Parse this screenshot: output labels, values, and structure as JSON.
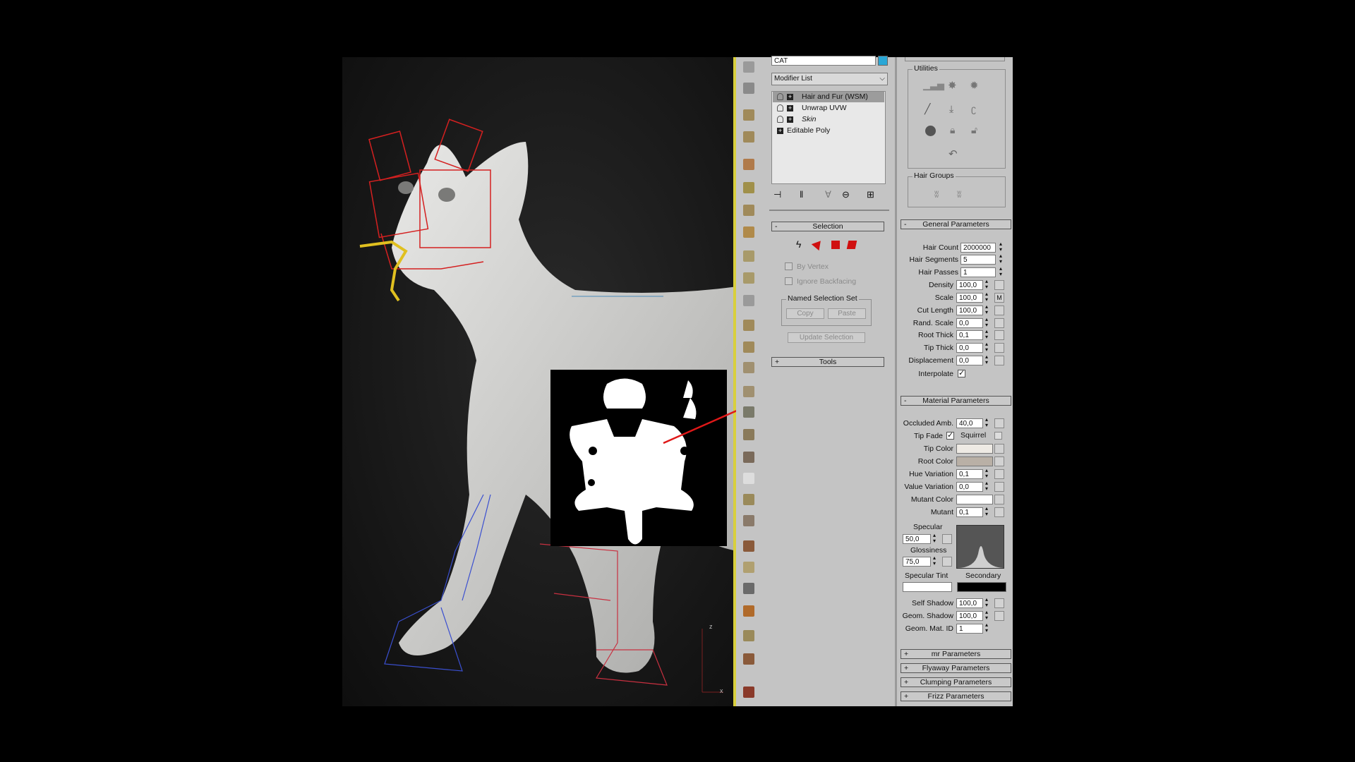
{
  "command_panel": {
    "object_name": "CAT",
    "object_color": "#2aa7d6",
    "modifier_list_label": "Modifier List",
    "stack": [
      {
        "label": "Hair and Fur (WSM)",
        "selected": true,
        "italic": false
      },
      {
        "label": "Unwrap UVW",
        "selected": false,
        "italic": false
      },
      {
        "label": "Skin",
        "selected": false,
        "italic": true
      },
      {
        "label": "Editable Poly",
        "selected": false,
        "italic": false
      }
    ]
  },
  "selection_rollout": {
    "sign": "-",
    "title": "Selection",
    "by_vertex": "By Vertex",
    "ignore_backfacing": "Ignore Backfacing",
    "named_selection_set": "Named Selection Set",
    "copy": "Copy",
    "paste": "Paste",
    "update_selection": "Update Selection"
  },
  "tools_rollout": {
    "sign": "+",
    "title": "Tools"
  },
  "utilities": {
    "title": "Utilities",
    "hair_groups_title": "Hair Groups"
  },
  "general_parameters": {
    "sign": "-",
    "title": "General Parameters",
    "rows": [
      {
        "label": "Hair Count",
        "value": "2000000"
      },
      {
        "label": "Hair Segments",
        "value": "5"
      },
      {
        "label": "Hair Passes",
        "value": "1"
      },
      {
        "label": "Density",
        "value": "100,0"
      },
      {
        "label": "Scale",
        "value": "100,0",
        "map": "M"
      },
      {
        "label": "Cut Length",
        "value": "100,0"
      },
      {
        "label": "Rand. Scale",
        "value": "0,0"
      },
      {
        "label": "Root Thick",
        "value": "0,1"
      },
      {
        "label": "Tip Thick",
        "value": "0,0"
      },
      {
        "label": "Displacement",
        "value": "0,0"
      }
    ],
    "interpolate_label": "Interpolate"
  },
  "material_parameters": {
    "sign": "-",
    "title": "Material Parameters",
    "occluded_amb_label": "Occluded Amb.",
    "occluded_amb_value": "40,0",
    "tip_fade_label": "Tip Fade",
    "squirrel_label": "Squirrel",
    "tip_color_label": "Tip Color",
    "tip_color": "#eeeae4",
    "root_color_label": "Root Color",
    "root_color": "#b9b0a6",
    "hue_variation_label": "Hue Variation",
    "hue_variation_value": "0,1",
    "value_variation_label": "Value Variation",
    "value_variation_value": "0,0",
    "mutant_color_label": "Mutant Color",
    "mutant_color": "#ffffff",
    "mutant_label": "Mutant",
    "mutant_value": "0,1",
    "specular_label": "Specular",
    "specular_value": "50,0",
    "glossiness_label": "Glossiness",
    "glossiness_value": "75,0",
    "specular_tint_label": "Specular Tint",
    "specular_tint": "#ffffff",
    "secondary_label": "Secondary",
    "secondary_color": "#000000",
    "self_shadow_label": "Self Shadow",
    "self_shadow_value": "100,0",
    "geom_shadow_label": "Geom. Shadow",
    "geom_shadow_value": "100,0",
    "geom_mat_id_label": "Geom. Mat. ID",
    "geom_mat_id_value": "1"
  },
  "collapsed_rollouts": [
    {
      "sign": "+",
      "title": "mr Parameters"
    },
    {
      "sign": "+",
      "title": "Flyaway Parameters"
    },
    {
      "sign": "+",
      "title": "Clumping Parameters"
    },
    {
      "sign": "+",
      "title": "Frizz Parameters"
    }
  ],
  "viewport": {
    "axis_label_z": "z",
    "axis_label_x": "x",
    "annotation_color": "#e01818"
  }
}
